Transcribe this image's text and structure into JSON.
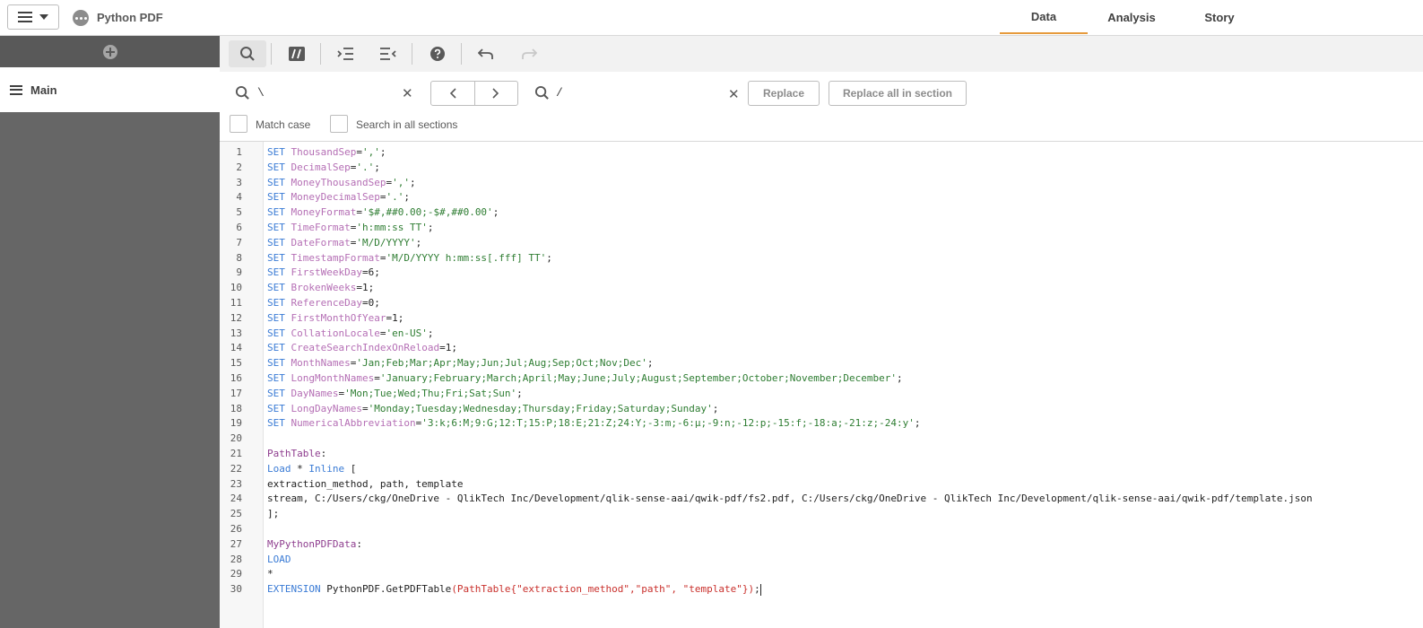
{
  "app": {
    "title": "Python PDF"
  },
  "tabs": [
    {
      "label": "Data",
      "active": true
    },
    {
      "label": "Analysis",
      "active": false
    },
    {
      "label": "Story",
      "active": false
    }
  ],
  "sidebar": {
    "section_label": "Main"
  },
  "toolbar": {
    "buttons": [
      "search-icon",
      "comment-icon",
      "indent-icon",
      "outdent-icon",
      "help-icon",
      "undo-icon",
      "redo-icon"
    ]
  },
  "find": {
    "search_value": "\\",
    "replace_value": "/",
    "replace_label": "Replace",
    "replace_all_label": "Replace all in section",
    "match_case_label": "Match case",
    "search_all_label": "Search in all sections"
  },
  "editor": {
    "line_numbers": [
      "1",
      "2",
      "3",
      "4",
      "5",
      "6",
      "7",
      "8",
      "9",
      "10",
      "11",
      "12",
      "13",
      "14",
      "15",
      "16",
      "17",
      "18",
      "19",
      "20",
      "21",
      "22",
      "23",
      "24",
      "25",
      "26",
      "27",
      "28",
      "29",
      "30"
    ],
    "lines": [
      [
        {
          "t": "kw",
          "v": "SET "
        },
        {
          "t": "vr",
          "v": "ThousandSep"
        },
        {
          "t": "ctx",
          "v": "="
        },
        {
          "t": "st",
          "v": "','"
        },
        {
          "t": "ctx",
          "v": ";"
        }
      ],
      [
        {
          "t": "kw",
          "v": "SET "
        },
        {
          "t": "vr",
          "v": "DecimalSep"
        },
        {
          "t": "ctx",
          "v": "="
        },
        {
          "t": "st",
          "v": "'.'"
        },
        {
          "t": "ctx",
          "v": ";"
        }
      ],
      [
        {
          "t": "kw",
          "v": "SET "
        },
        {
          "t": "vr",
          "v": "MoneyThousandSep"
        },
        {
          "t": "ctx",
          "v": "="
        },
        {
          "t": "st",
          "v": "','"
        },
        {
          "t": "ctx",
          "v": ";"
        }
      ],
      [
        {
          "t": "kw",
          "v": "SET "
        },
        {
          "t": "vr",
          "v": "MoneyDecimalSep"
        },
        {
          "t": "ctx",
          "v": "="
        },
        {
          "t": "st",
          "v": "'.'"
        },
        {
          "t": "ctx",
          "v": ";"
        }
      ],
      [
        {
          "t": "kw",
          "v": "SET "
        },
        {
          "t": "vr",
          "v": "MoneyFormat"
        },
        {
          "t": "ctx",
          "v": "="
        },
        {
          "t": "st",
          "v": "'$#,##0.00;-$#,##0.00'"
        },
        {
          "t": "ctx",
          "v": ";"
        }
      ],
      [
        {
          "t": "kw",
          "v": "SET "
        },
        {
          "t": "vr",
          "v": "TimeFormat"
        },
        {
          "t": "ctx",
          "v": "="
        },
        {
          "t": "st",
          "v": "'h:mm:ss TT'"
        },
        {
          "t": "ctx",
          "v": ";"
        }
      ],
      [
        {
          "t": "kw",
          "v": "SET "
        },
        {
          "t": "vr",
          "v": "DateFormat"
        },
        {
          "t": "ctx",
          "v": "="
        },
        {
          "t": "st",
          "v": "'M/D/YYYY'"
        },
        {
          "t": "ctx",
          "v": ";"
        }
      ],
      [
        {
          "t": "kw",
          "v": "SET "
        },
        {
          "t": "vr",
          "v": "TimestampFormat"
        },
        {
          "t": "ctx",
          "v": "="
        },
        {
          "t": "st",
          "v": "'M/D/YYYY h:mm:ss[.fff] TT'"
        },
        {
          "t": "ctx",
          "v": ";"
        }
      ],
      [
        {
          "t": "kw",
          "v": "SET "
        },
        {
          "t": "vr",
          "v": "FirstWeekDay"
        },
        {
          "t": "ctx",
          "v": "=6;"
        }
      ],
      [
        {
          "t": "kw",
          "v": "SET "
        },
        {
          "t": "vr",
          "v": "BrokenWeeks"
        },
        {
          "t": "ctx",
          "v": "=1;"
        }
      ],
      [
        {
          "t": "kw",
          "v": "SET "
        },
        {
          "t": "vr",
          "v": "ReferenceDay"
        },
        {
          "t": "ctx",
          "v": "=0;"
        }
      ],
      [
        {
          "t": "kw",
          "v": "SET "
        },
        {
          "t": "vr",
          "v": "FirstMonthOfYear"
        },
        {
          "t": "ctx",
          "v": "=1;"
        }
      ],
      [
        {
          "t": "kw",
          "v": "SET "
        },
        {
          "t": "vr",
          "v": "CollationLocale"
        },
        {
          "t": "ctx",
          "v": "="
        },
        {
          "t": "st",
          "v": "'en-US'"
        },
        {
          "t": "ctx",
          "v": ";"
        }
      ],
      [
        {
          "t": "kw",
          "v": "SET "
        },
        {
          "t": "vr",
          "v": "CreateSearchIndexOnReload"
        },
        {
          "t": "ctx",
          "v": "=1;"
        }
      ],
      [
        {
          "t": "kw",
          "v": "SET "
        },
        {
          "t": "vr",
          "v": "MonthNames"
        },
        {
          "t": "ctx",
          "v": "="
        },
        {
          "t": "st",
          "v": "'Jan;Feb;Mar;Apr;May;Jun;Jul;Aug;Sep;Oct;Nov;Dec'"
        },
        {
          "t": "ctx",
          "v": ";"
        }
      ],
      [
        {
          "t": "kw",
          "v": "SET "
        },
        {
          "t": "vr",
          "v": "LongMonthNames"
        },
        {
          "t": "ctx",
          "v": "="
        },
        {
          "t": "st",
          "v": "'January;February;March;April;May;June;July;August;September;October;November;December'"
        },
        {
          "t": "ctx",
          "v": ";"
        }
      ],
      [
        {
          "t": "kw",
          "v": "SET "
        },
        {
          "t": "vr",
          "v": "DayNames"
        },
        {
          "t": "ctx",
          "v": "="
        },
        {
          "t": "st",
          "v": "'Mon;Tue;Wed;Thu;Fri;Sat;Sun'"
        },
        {
          "t": "ctx",
          "v": ";"
        }
      ],
      [
        {
          "t": "kw",
          "v": "SET "
        },
        {
          "t": "vr",
          "v": "LongDayNames"
        },
        {
          "t": "ctx",
          "v": "="
        },
        {
          "t": "st",
          "v": "'Monday;Tuesday;Wednesday;Thursday;Friday;Saturday;Sunday'"
        },
        {
          "t": "ctx",
          "v": ";"
        }
      ],
      [
        {
          "t": "kw",
          "v": "SET "
        },
        {
          "t": "vr",
          "v": "NumericalAbbreviation"
        },
        {
          "t": "ctx",
          "v": "="
        },
        {
          "t": "st",
          "v": "'3:k;6:M;9:G;12:T;15:P;18:E;21:Z;24:Y;-3:m;-6:μ;-9:n;-12:p;-15:f;-18:a;-21:z;-24:y'"
        },
        {
          "t": "ctx",
          "v": ";"
        }
      ],
      [],
      [
        {
          "t": "lb",
          "v": "PathTable"
        },
        {
          "t": "ctx",
          "v": ":"
        }
      ],
      [
        {
          "t": "kw",
          "v": "Load"
        },
        {
          "t": "ctx",
          "v": " * "
        },
        {
          "t": "kw",
          "v": "Inline"
        },
        {
          "t": "ctx",
          "v": " ["
        }
      ],
      [
        {
          "t": "ctx",
          "v": "extraction_method, path, template"
        }
      ],
      [
        {
          "t": "ctx",
          "v": "stream, C:/Users/ckg/OneDrive - QlikTech Inc/Development/qlik-sense-aai/qwik-pdf/fs2.pdf, C:/Users/ckg/OneDrive - QlikTech Inc/Development/qlik-sense-aai/qwik-pdf/template.json"
        }
      ],
      [
        {
          "t": "ctx",
          "v": "];"
        }
      ],
      [],
      [
        {
          "t": "lb",
          "v": "MyPythonPDFData"
        },
        {
          "t": "ctx",
          "v": ":"
        }
      ],
      [
        {
          "t": "kw",
          "v": "LOAD"
        }
      ],
      [
        {
          "t": "ctx",
          "v": "*"
        }
      ],
      [
        {
          "t": "kw",
          "v": "EXTENSION"
        },
        {
          "t": "ctx",
          "v": " PythonPDF.GetPDFTable"
        },
        {
          "t": "err",
          "v": "(PathTable{\"extraction_method\",\"path\", \"template\"})"
        },
        {
          "t": "ctx",
          "v": ";"
        }
      ]
    ]
  }
}
